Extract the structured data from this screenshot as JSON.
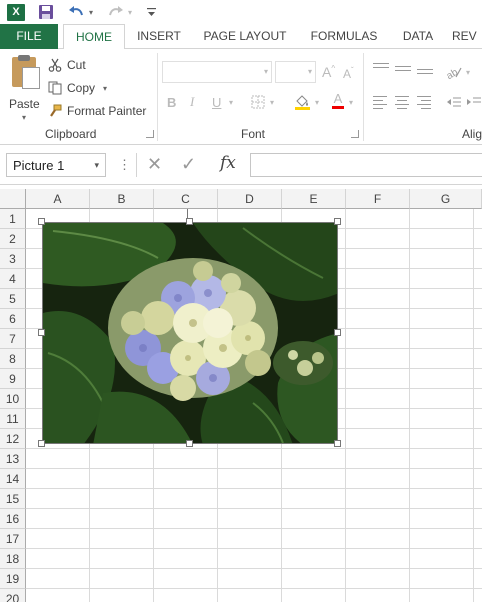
{
  "app": {
    "title_icon": "excel-logo-icon",
    "excel_logo_letter": "X"
  },
  "tabs": {
    "file": "FILE",
    "home": "HOME",
    "insert": "INSERT",
    "page_layout": "PAGE LAYOUT",
    "formulas": "FORMULAS",
    "data": "DATA",
    "review": "REV"
  },
  "ribbon": {
    "clipboard": {
      "paste": "Paste",
      "cut": "Cut",
      "copy": "Copy",
      "format_painter": "Format Painter",
      "group_label": "Clipboard"
    },
    "font": {
      "font_name": "",
      "font_size": "",
      "group_label": "Font",
      "bold": "B",
      "italic": "I",
      "underline": "U",
      "grow": "A",
      "shrink": "A",
      "font_color": "A"
    },
    "alignment": {
      "group_label": "Alig"
    }
  },
  "formula_bar": {
    "name_box": "Picture 1",
    "fx": "fx",
    "formula": ""
  },
  "grid": {
    "columns": [
      "A",
      "B",
      "C",
      "D",
      "E",
      "F",
      "G"
    ],
    "rows": [
      "1",
      "2",
      "3",
      "4",
      "5",
      "6",
      "7",
      "8",
      "9",
      "10",
      "11",
      "12",
      "13",
      "14",
      "15",
      "16",
      "17",
      "18",
      "19",
      "20"
    ]
  },
  "picture": {
    "name": "Picture 1",
    "subject": "hydrangea flower photo"
  },
  "colors": {
    "accent": "#217346",
    "grid_line": "#dadada",
    "header_bg": "#f3f3f3"
  }
}
